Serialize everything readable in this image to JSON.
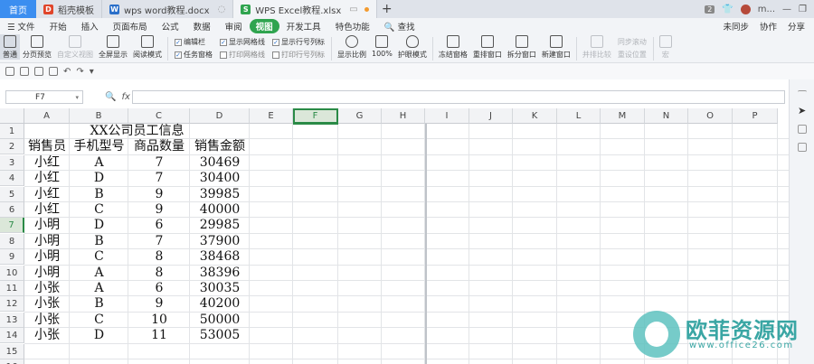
{
  "tabs": {
    "home": "首页",
    "items": [
      {
        "label": "稻壳模板",
        "icon_color": "#e0452a",
        "icon": "D"
      },
      {
        "label": "wps word教程.docx",
        "icon_color": "#2a6fc9",
        "icon": "W"
      },
      {
        "label": "WPS Excel教程.xlsx",
        "icon_color": "#2fa44f",
        "icon": "S"
      }
    ],
    "badge_count": "2",
    "user": "m..."
  },
  "menu": {
    "file": "文件",
    "items": [
      "开始",
      "插入",
      "页面布局",
      "公式",
      "数据",
      "审阅",
      "视图",
      "开发工具",
      "特色功能"
    ],
    "active": "视图",
    "search": "查找",
    "right": [
      "未同步",
      "协作",
      "分享"
    ]
  },
  "ribbon": {
    "buttons": [
      {
        "label": "普通",
        "active": true
      },
      {
        "label": "分页预览"
      },
      {
        "label": "自定义视图",
        "disabled": true
      },
      {
        "label": "全屏显示"
      },
      {
        "label": "阅读模式"
      }
    ],
    "checks1": [
      {
        "label": "编辑栏",
        "checked": true
      },
      {
        "label": "任务窗格",
        "checked": true
      }
    ],
    "checks2": [
      {
        "label": "显示网格线",
        "checked": true
      },
      {
        "label": "打印网格线",
        "checked": false
      }
    ],
    "checks3": [
      {
        "label": "显示行号列标",
        "checked": true
      },
      {
        "label": "打印行号列标",
        "checked": false
      }
    ],
    "buttons2": [
      {
        "label": "显示比例"
      },
      {
        "label": "100%"
      },
      {
        "label": "护眼模式"
      },
      {
        "label": "冻结窗格"
      },
      {
        "label": "重排窗口"
      },
      {
        "label": "拆分窗口"
      },
      {
        "label": "新建窗口"
      },
      {
        "label": "并排比较",
        "disabled": true
      },
      {
        "label": "同步滚动",
        "disabled": true
      },
      {
        "label": "宏",
        "disabled": true
      }
    ],
    "reset_position": "重设位置"
  },
  "formula": {
    "cell_ref": "F7",
    "fx": "fx",
    "value": ""
  },
  "grid": {
    "columns": [
      "A",
      "B",
      "C",
      "D",
      "E",
      "F",
      "G",
      "H",
      "I",
      "J",
      "K",
      "L",
      "M",
      "N",
      "O",
      "P"
    ],
    "selected_column": "F",
    "selected_row": 7,
    "rows": [
      "1",
      "2",
      "3",
      "4",
      "5",
      "6",
      "7",
      "8",
      "9",
      "10",
      "11",
      "12",
      "13",
      "14",
      "15",
      "16"
    ],
    "title": "XX公司员工信息",
    "headers": [
      "销售员",
      "手机型号",
      "商品数量",
      "销售金额"
    ],
    "data": [
      [
        "小红",
        "A",
        "7",
        "30469"
      ],
      [
        "小红",
        "D",
        "7",
        "30400"
      ],
      [
        "小红",
        "B",
        "9",
        "39985"
      ],
      [
        "小红",
        "C",
        "9",
        "40000"
      ],
      [
        "小明",
        "D",
        "6",
        "29985"
      ],
      [
        "小明",
        "B",
        "7",
        "37900"
      ],
      [
        "小明",
        "C",
        "8",
        "38468"
      ],
      [
        "小明",
        "A",
        "8",
        "38396"
      ],
      [
        "小张",
        "A",
        "6",
        "30035"
      ],
      [
        "小张",
        "B",
        "9",
        "40200"
      ],
      [
        "小张",
        "C",
        "10",
        "50000"
      ],
      [
        "小张",
        "D",
        "11",
        "53005"
      ]
    ]
  },
  "watermark": {
    "name": "欧菲资源网",
    "url": "www.office26.com"
  }
}
